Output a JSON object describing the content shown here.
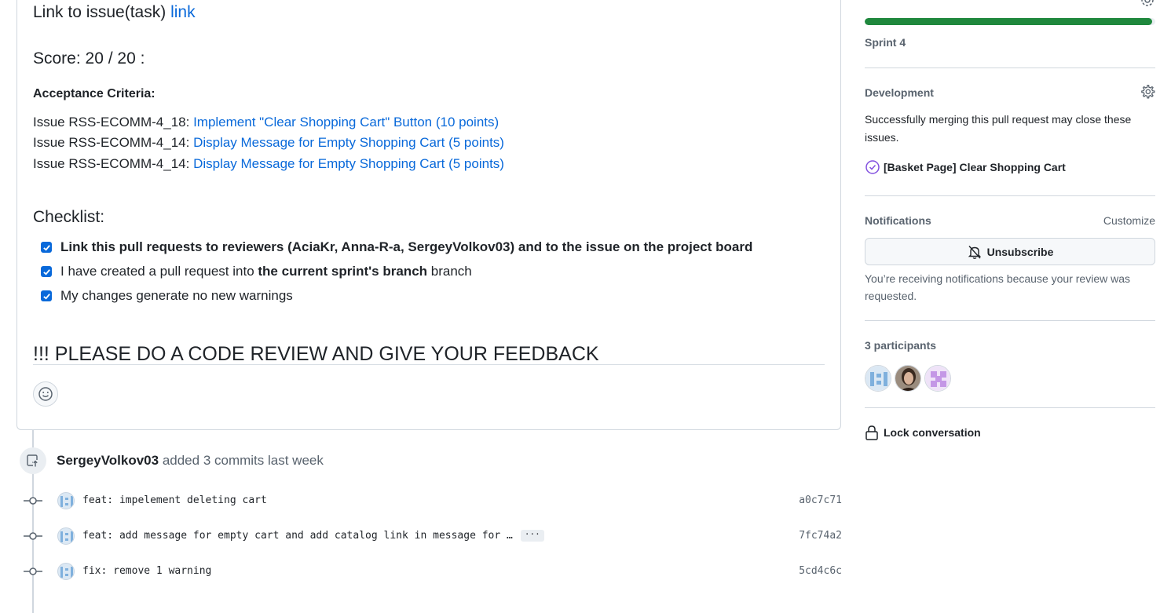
{
  "comment": {
    "link_heading_prefix": "Link to issue(task) ",
    "link_heading_link": "link",
    "score_heading": "Score: 20 / 20 :",
    "acceptance_title": "Acceptance Criteria:",
    "issues": [
      {
        "prefix": "Issue RSS-ECOMM-4_18: ",
        "link": "Implement \"Clear Shopping Cart\" Button (10 points)"
      },
      {
        "prefix": "Issue RSS-ECOMM-4_14: ",
        "link": "Display Message for Empty Shopping Cart (5 points)"
      },
      {
        "prefix": "Issue RSS-ECOMM-4_14: ",
        "link": "Display Message for Empty Shopping Cart (5 points)"
      }
    ],
    "checklist_heading": "Checklist:",
    "checklist": [
      {
        "text": "Link this pull requests to reviewers (AciaKr, Anna-R-a, SergeyVolkov03) and to the issue on the project board",
        "checked": true
      },
      {
        "pre": "I have created a pull request into ",
        "bold": "the current sprint's branch",
        "post": " branch",
        "checked": true
      },
      {
        "text": "My changes generate no new warnings",
        "checked": true
      }
    ],
    "please_heading": "!!! PLEASE DO A CODE REVIEW AND GIVE YOUR FEEDBACK",
    "emoji_icon": "smiley-icon"
  },
  "timeline": {
    "push_author": "SergeyVolkov03",
    "push_text": " added 3 commits last week",
    "commits": [
      {
        "message": "feat: impelement deleting cart",
        "sha": "a0c7c71",
        "truncated": false
      },
      {
        "message": "feat: add message for empty cart and add catalog link in message for …",
        "sha": "7fc74a2",
        "truncated": true,
        "ellipsis": "···"
      },
      {
        "message": "fix: remove 1 warning",
        "sha": "5cd4c6c",
        "truncated": false
      }
    ]
  },
  "sidebar": {
    "milestone": {
      "progress": 0.99,
      "name": "Sprint 4",
      "color": "#1f883d"
    },
    "development": {
      "heading": "Development",
      "description": "Successfully merging this pull request may close these issues.",
      "issue": "[Basket Page] Clear Shopping Cart",
      "issue_color": "#8250df"
    },
    "notifications": {
      "heading": "Notifications",
      "customize": "Customize",
      "button": "Unsubscribe",
      "description": "You’re receiving notifications because your review was requested."
    },
    "participants": {
      "heading": "3 participants",
      "count": 3
    },
    "lock": "Lock conversation"
  }
}
